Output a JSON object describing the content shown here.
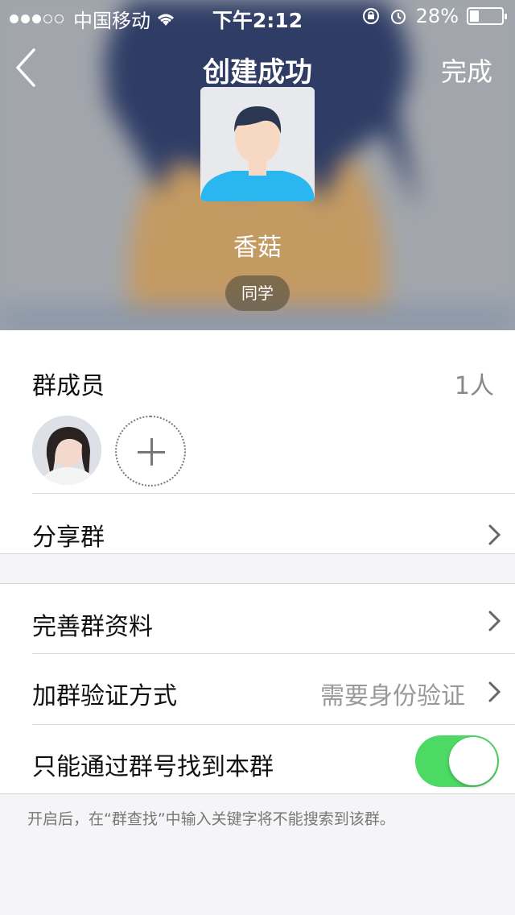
{
  "status_bar": {
    "carrier": "中国移动",
    "time": "下午2:12",
    "battery_pct": "28%",
    "battery_level": 0.28,
    "signal_icon": "signal-dots-icon",
    "wifi_icon": "wifi-icon",
    "rotation_lock_icon": "rotation-lock-icon",
    "alarm_icon": "alarm-icon"
  },
  "nav": {
    "back_icon": "chevron-left-icon",
    "title": "创建成功",
    "done_label": "完成"
  },
  "group": {
    "avatar_icon": "default-person-avatar",
    "name": "香菇",
    "tag": "同学"
  },
  "members": {
    "label": "群成员",
    "count": "1人",
    "add_icon": "plus-icon"
  },
  "rows": {
    "share": "分享群",
    "improve_profile": "完善群资料",
    "join_method_label": "加群验证方式",
    "join_method_value": "需要身份验证",
    "search_only_label": "只能通过群号找到本群",
    "search_only_enabled": true
  },
  "footnote": "开启后，在“群查找”中输入关键字将不能搜索到该群。",
  "colors": {
    "toggle_on": "#4cd964",
    "chip_bg": "#6f6450",
    "text_secondary": "#999999"
  }
}
